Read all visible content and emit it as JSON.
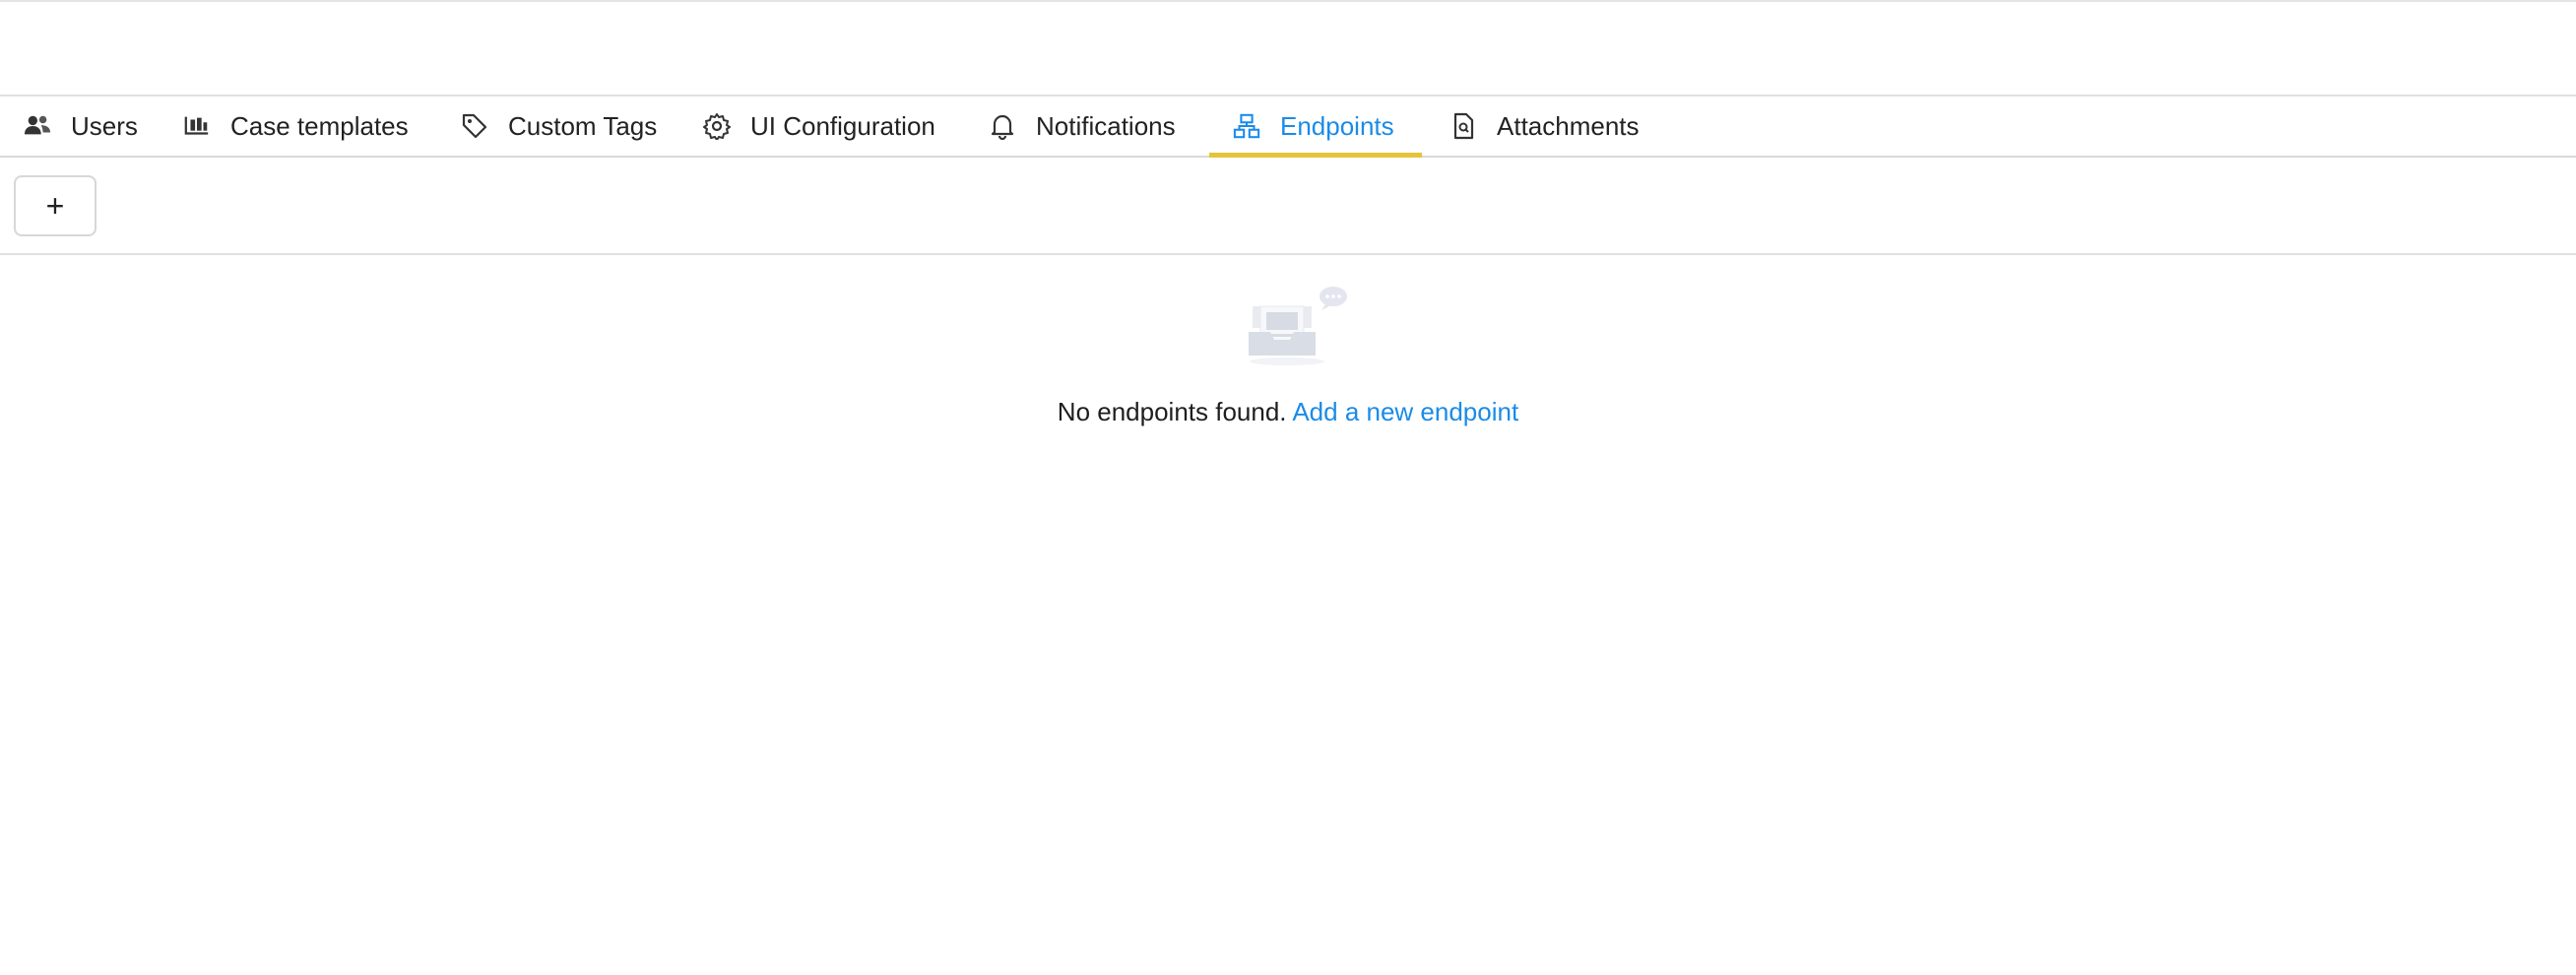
{
  "tabs": [
    {
      "label": "Users",
      "icon": "users-icon",
      "active": false
    },
    {
      "label": "Case templates",
      "icon": "case-templates-icon",
      "active": false
    },
    {
      "label": "Custom Tags",
      "icon": "tag-icon",
      "active": false
    },
    {
      "label": "UI Configuration",
      "icon": "gear-icon",
      "active": false
    },
    {
      "label": "Notifications",
      "icon": "bell-icon",
      "active": false
    },
    {
      "label": "Endpoints",
      "icon": "endpoints-icon",
      "active": true
    },
    {
      "label": "Attachments",
      "icon": "attachment-file-icon",
      "active": false
    }
  ],
  "toolbar": {
    "add_label": "+"
  },
  "empty_state": {
    "message": "No endpoints found.",
    "link": "Add a new endpoint"
  },
  "colors": {
    "accent": "#1a8be8",
    "active_underline": "#e6c33a"
  }
}
